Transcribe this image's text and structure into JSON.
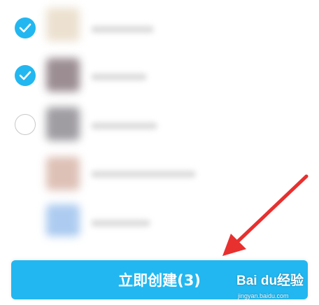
{
  "button": {
    "label": "立即创建(3)"
  },
  "watermark": {
    "brand": "Bai du经验",
    "url": "jingyan.baidu.com"
  },
  "colors": {
    "accent": "#22b7f0",
    "arrow": "#e8302f"
  },
  "contacts": [
    {
      "checked": true
    },
    {
      "checked": true
    },
    {
      "checked": false
    },
    {
      "checked": false
    },
    {
      "checked": false
    }
  ]
}
